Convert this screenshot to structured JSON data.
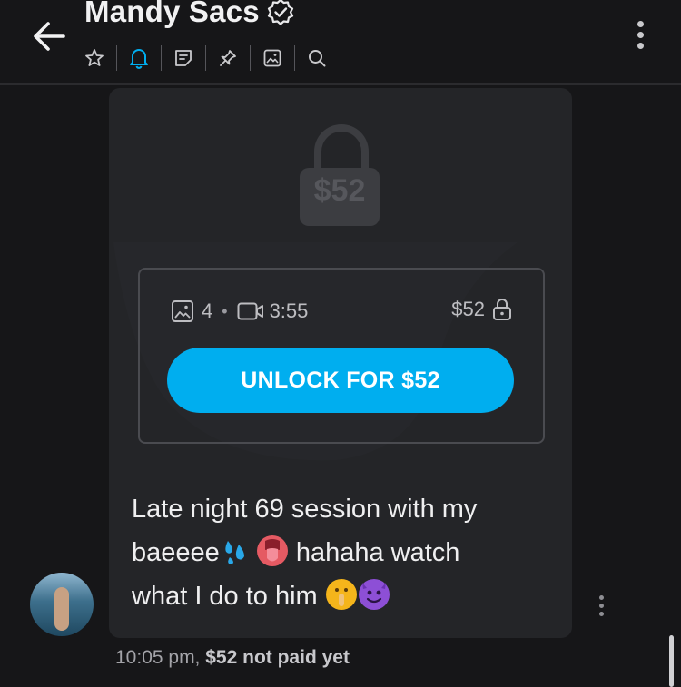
{
  "header": {
    "title": "Mandy Sacs",
    "back_icon": "arrow-left-icon",
    "verified_icon": "verified-badge-icon",
    "toolbar_icons": [
      "star-icon",
      "bell-icon",
      "note-icon",
      "pin-icon",
      "image-icon",
      "search-icon"
    ],
    "accent_color": "#00aeef"
  },
  "message": {
    "locked_price": "$52",
    "media": {
      "photo_count": "4",
      "separator": "•",
      "video_duration": "3:55",
      "price": "$52"
    },
    "unlock_button_label": "UNLOCK FOR $52",
    "text_line1": "Late night 69 session with my",
    "text_line2a": "baeeee",
    "text_line2b": " hahaha watch",
    "text_line3": "what I do to him ",
    "emojis": [
      "sweat-droplets-emoji",
      "tongue-emoji",
      "shushing-face-emoji",
      "smiling-devil-emoji"
    ],
    "time": "10:05 pm,",
    "payment_status": "$52 not paid yet"
  }
}
